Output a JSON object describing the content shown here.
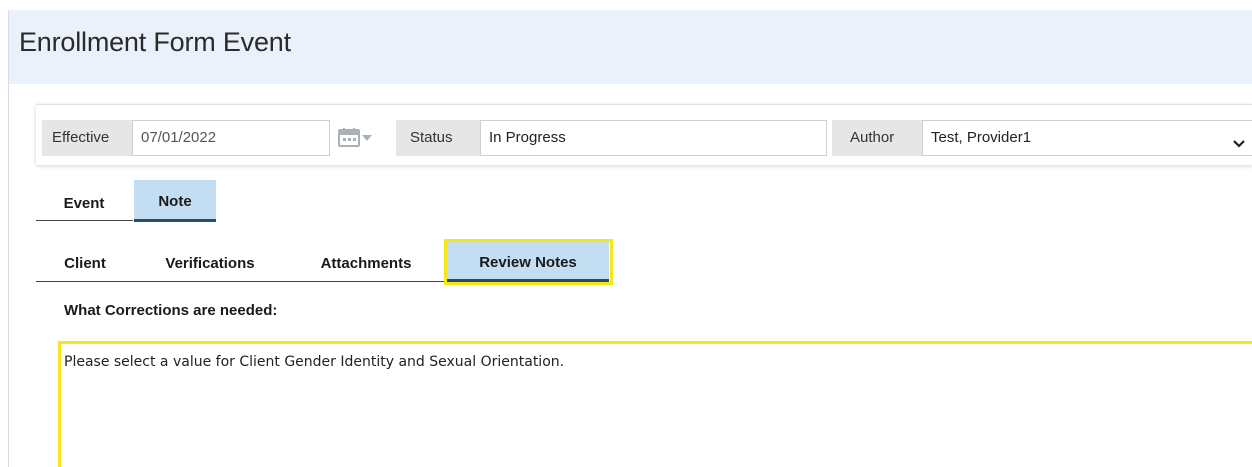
{
  "page": {
    "title": "Enrollment Form Event"
  },
  "toolbar": {
    "effective_label": "Effective",
    "effective_value": "07/01/2022",
    "status_label": "Status",
    "status_value": "In Progress",
    "author_label": "Author",
    "author_value": "Test, Provider1"
  },
  "primary_tabs": [
    {
      "label": "Event",
      "active": false
    },
    {
      "label": "Note",
      "active": true
    }
  ],
  "secondary_tabs": [
    {
      "label": "Client",
      "active": false
    },
    {
      "label": "Verifications",
      "active": false
    },
    {
      "label": "Attachments",
      "active": false
    },
    {
      "label": "Review Notes",
      "active": true
    }
  ],
  "review": {
    "question_label": "What Corrections are needed:",
    "notes_text": "Please select a value for Client Gender Identity and Sexual Orientation."
  },
  "icons": {
    "calendar": "calendar-icon",
    "dropdown": "chevron-down-icon"
  },
  "colors": {
    "header_bg": "#eaf1fa",
    "active_tab_bg": "#c3def3",
    "active_tab_border": "#234d6b",
    "highlight": "#f5e71a"
  }
}
